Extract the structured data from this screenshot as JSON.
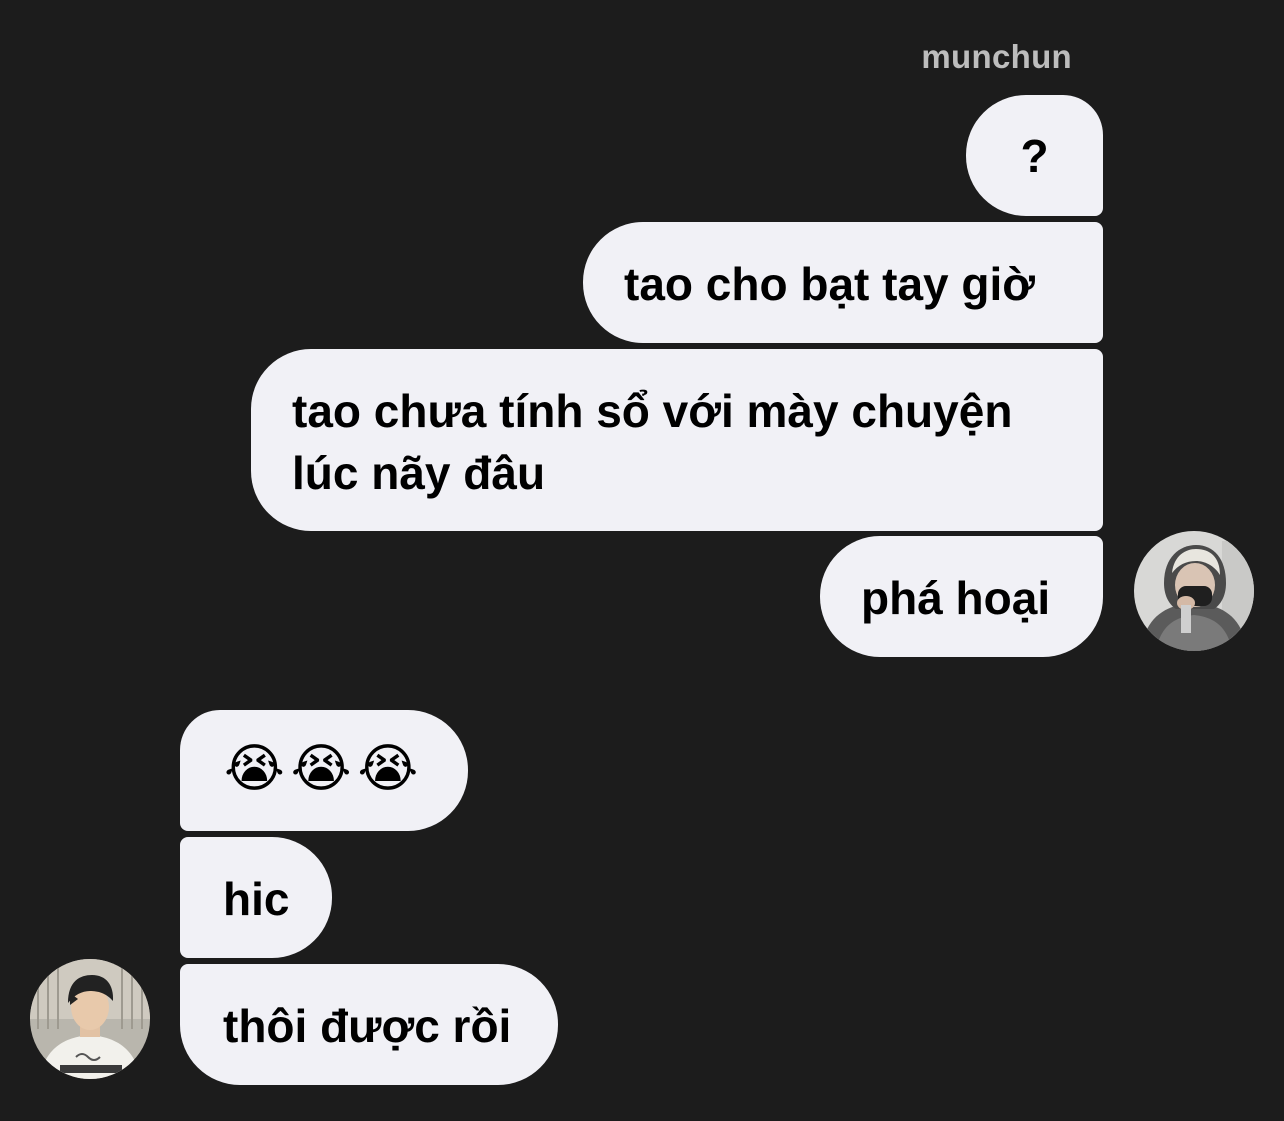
{
  "conversation": {
    "sender_name": "munchun",
    "outgoing_messages": [
      {
        "text": "?"
      },
      {
        "text": "tao cho bạt tay giờ"
      },
      {
        "lines": [
          "tao chưa tính sổ với mày chuyện",
          "lúc nãy đâu"
        ]
      },
      {
        "text": "phá hoại"
      }
    ],
    "incoming_messages": [
      {
        "text": "😭😭😭"
      },
      {
        "text": "hic"
      },
      {
        "text": "thôi được rồi"
      }
    ]
  },
  "colors": {
    "background": "#1c1c1c",
    "bubble": "#f1f1f6",
    "sender_name": "#bdbdbd"
  },
  "icons": {
    "right_avatar": "avatar-photo",
    "left_avatar": "avatar-photo"
  }
}
